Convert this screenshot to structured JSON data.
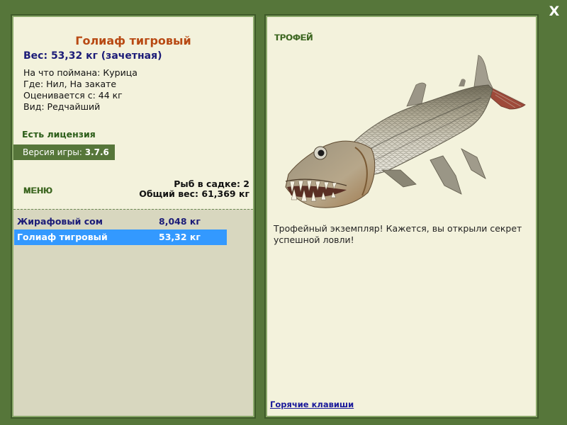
{
  "window": {
    "close_label": "X"
  },
  "fish": {
    "title": "Голиаф тигровый",
    "weight": "Вес: 53,32 кг (зачетная)",
    "bait": "На что поймана: Курица",
    "location": "Где: Нил, На закате",
    "rated_from": "Оценивается с: 44 кг",
    "rarity": "Вид: Редчайший"
  },
  "license": "Есть лицензия",
  "version": {
    "label": "Версия игры:",
    "value": "3.7.6"
  },
  "menu_label": "МЕНЮ",
  "cage": {
    "count": "Рыб в садке: 2",
    "total_weight": "Общий вес: 61,369 кг"
  },
  "catch_list": [
    {
      "name": "Жирафовый сом",
      "weight": "8,048 кг",
      "selected": false
    },
    {
      "name": "Голиаф тигровый",
      "weight": "53,32 кг",
      "selected": true
    }
  ],
  "trophy": {
    "label": "ТРОФЕЙ",
    "text": "Трофейный экземпляр! Кажется, вы открыли секрет успешной ловли!",
    "image_icon": "goliath-tigerfish-illustration"
  },
  "hotkeys_link": "Горячие клавиши",
  "colors": {
    "frame": "#56763a",
    "panel": "#f3f2dc",
    "list_bg": "#d8d7bf",
    "title": "#b84a14",
    "weight": "#1c1c78",
    "license": "#2b5d18",
    "selection": "#3399ff"
  }
}
